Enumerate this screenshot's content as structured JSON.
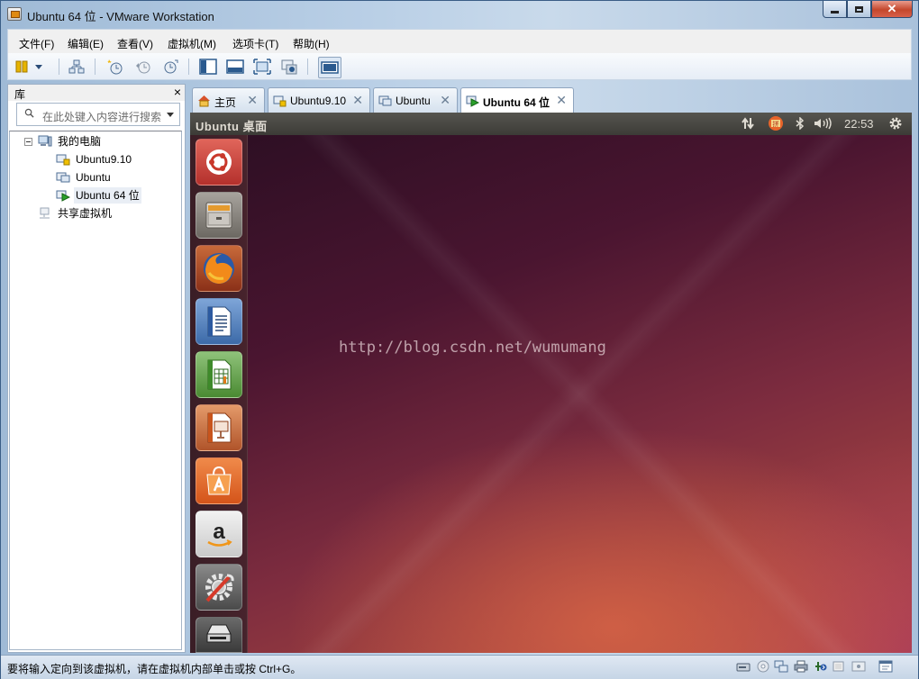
{
  "window": {
    "title": "Ubuntu 64 位 - VMware Workstation"
  },
  "menu": [
    "文件(F)",
    "编辑(E)",
    "查看(V)",
    "虚拟机(M)",
    "选项卡(T)",
    "帮助(H)"
  ],
  "library": {
    "title": "库",
    "search_placeholder": "在此处键入内容进行搜索",
    "tree": {
      "root": "我的电脑",
      "vms": [
        "Ubuntu9.10",
        "Ubuntu",
        "Ubuntu 64 位"
      ],
      "shared": "共享虚拟机"
    }
  },
  "tabs": [
    {
      "label": "主页",
      "icon": "home-icon"
    },
    {
      "label": "Ubuntu9.10",
      "icon": "vm-locked-icon"
    },
    {
      "label": "Ubuntu",
      "icon": "vm-icon"
    },
    {
      "label": "Ubuntu 64 位",
      "icon": "vm-running-icon",
      "active": true
    }
  ],
  "guest": {
    "panel_title": "Ubuntu 桌面",
    "clock": "22:53",
    "watermark": "http://blog.csdn.net/wumumang",
    "launcher": [
      "ubuntu-dash-icon",
      "files-icon",
      "firefox-icon",
      "writer-icon",
      "calc-icon",
      "impress-icon",
      "software-center-icon",
      "amazon-icon",
      "system-settings-icon",
      "removable-drive-icon"
    ]
  },
  "status": {
    "message": "要将输入定向到该虚拟机，请在虚拟机内部单击或按 Ctrl+G。"
  },
  "colors": {
    "accent": "#3a5d86",
    "desktop": "#7d2c3f",
    "panel": "#3c3b37"
  }
}
